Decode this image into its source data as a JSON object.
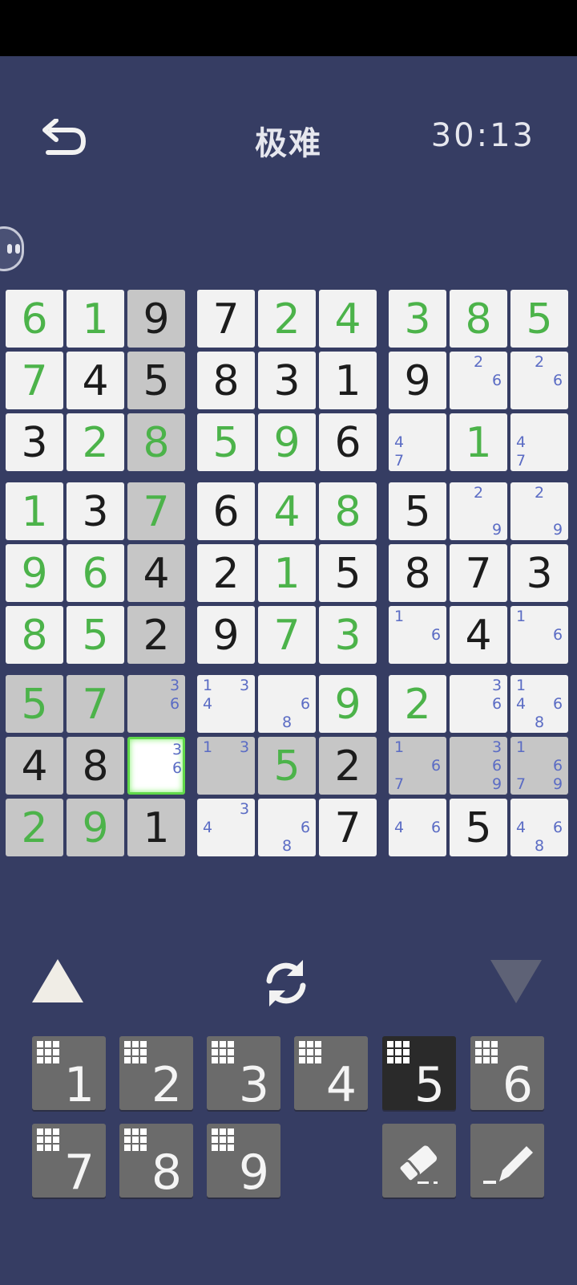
{
  "header": {
    "title": "极难",
    "timer": "30:13"
  },
  "board": {
    "values": [
      [
        "6",
        "1",
        "9",
        "7",
        "2",
        "4",
        "3",
        "8",
        "5"
      ],
      [
        "7",
        "4",
        "5",
        "8",
        "3",
        "1",
        "9",
        "",
        ""
      ],
      [
        "3",
        "2",
        "8",
        "5",
        "9",
        "6",
        "",
        "1",
        ""
      ],
      [
        "1",
        "3",
        "7",
        "6",
        "4",
        "8",
        "5",
        "",
        ""
      ],
      [
        "9",
        "6",
        "4",
        "2",
        "1",
        "5",
        "8",
        "7",
        "3"
      ],
      [
        "8",
        "5",
        "2",
        "9",
        "7",
        "3",
        "",
        "4",
        ""
      ],
      [
        "5",
        "7",
        "",
        "",
        "",
        "9",
        "2",
        "",
        ""
      ],
      [
        "4",
        "8",
        "",
        "",
        "5",
        "2",
        "",
        "",
        ""
      ],
      [
        "2",
        "9",
        "1",
        "",
        "",
        "7",
        "",
        "5",
        ""
      ]
    ],
    "kinds": [
      [
        "e",
        "e",
        "g",
        "g",
        "e",
        "e",
        "e",
        "e",
        "e"
      ],
      [
        "e",
        "g",
        "g",
        "g",
        "g",
        "g",
        "g",
        "",
        ""
      ],
      [
        "g",
        "e",
        "e",
        "e",
        "e",
        "g",
        "",
        "e",
        ""
      ],
      [
        "e",
        "g",
        "e",
        "g",
        "e",
        "e",
        "g",
        "",
        ""
      ],
      [
        "e",
        "e",
        "g",
        "g",
        "e",
        "g",
        "g",
        "g",
        "g"
      ],
      [
        "e",
        "e",
        "g",
        "g",
        "e",
        "e",
        "",
        "g",
        ""
      ],
      [
        "e",
        "e",
        "",
        "",
        "",
        "e",
        "e",
        "",
        ""
      ],
      [
        "g",
        "g",
        "",
        "",
        "e",
        "g",
        "",
        "",
        ""
      ],
      [
        "e",
        "e",
        "g",
        "",
        "",
        "g",
        "",
        "g",
        ""
      ]
    ],
    "notes": [
      [
        [],
        [],
        [],
        [],
        [],
        [],
        [],
        [],
        []
      ],
      [
        [],
        [],
        [],
        [],
        [],
        [],
        [],
        [
          "2",
          "6"
        ],
        [
          "2",
          "6"
        ]
      ],
      [
        [],
        [],
        [],
        [],
        [],
        [],
        [
          "4",
          "7"
        ],
        [],
        [
          "4",
          "7"
        ]
      ],
      [
        [],
        [],
        [],
        [],
        [],
        [],
        [],
        [
          "2",
          "9"
        ],
        [
          "2",
          "9"
        ]
      ],
      [
        [],
        [],
        [],
        [],
        [],
        [],
        [],
        [],
        []
      ],
      [
        [],
        [],
        [],
        [],
        [],
        [],
        [
          "1",
          "6"
        ],
        [],
        [
          "1",
          "6"
        ]
      ],
      [
        [],
        [],
        [
          "3",
          "6"
        ],
        [
          "1",
          "3",
          "4"
        ],
        [
          "6",
          "8"
        ],
        [],
        [],
        [
          "3",
          "6"
        ],
        [
          "1",
          "4",
          "6",
          "8"
        ]
      ],
      [
        [],
        [],
        [
          "3",
          "6"
        ],
        [
          "1",
          "3"
        ],
        [],
        [],
        [
          "1",
          "6",
          "7"
        ],
        [
          "3",
          "6",
          "9"
        ],
        [
          "1",
          "6",
          "7",
          "9"
        ]
      ],
      [
        [],
        [],
        [],
        [
          "3",
          "4"
        ],
        [
          "6",
          "8"
        ],
        [],
        [
          "4",
          "6"
        ],
        [],
        [
          "4",
          "6",
          "8"
        ]
      ]
    ],
    "gray_cells": [
      [
        0,
        2
      ],
      [
        1,
        2
      ],
      [
        2,
        2
      ],
      [
        3,
        2
      ],
      [
        4,
        2
      ],
      [
        5,
        2
      ],
      [
        6,
        0
      ],
      [
        6,
        1
      ],
      [
        6,
        2
      ],
      [
        7,
        0
      ],
      [
        7,
        1
      ],
      [
        7,
        3
      ],
      [
        7,
        4
      ],
      [
        7,
        5
      ],
      [
        7,
        6
      ],
      [
        7,
        7
      ],
      [
        7,
        8
      ],
      [
        8,
        0
      ],
      [
        8,
        1
      ],
      [
        8,
        2
      ]
    ],
    "selected": [
      7,
      2
    ]
  },
  "controls": {
    "prev": "triangle-up-icon",
    "rotate": "refresh-icon",
    "next": "triangle-down-icon"
  },
  "keypad": {
    "digits": [
      "1",
      "2",
      "3",
      "4",
      "5",
      "6",
      "7",
      "8",
      "9"
    ],
    "active_digit": "5",
    "eraser": "eraser-icon",
    "pencil": "pencil-icon"
  },
  "colors": {
    "background": "#363d63",
    "entered": "#4cb34a",
    "notes": "#5b6cc4",
    "selection": "#60d84a"
  }
}
